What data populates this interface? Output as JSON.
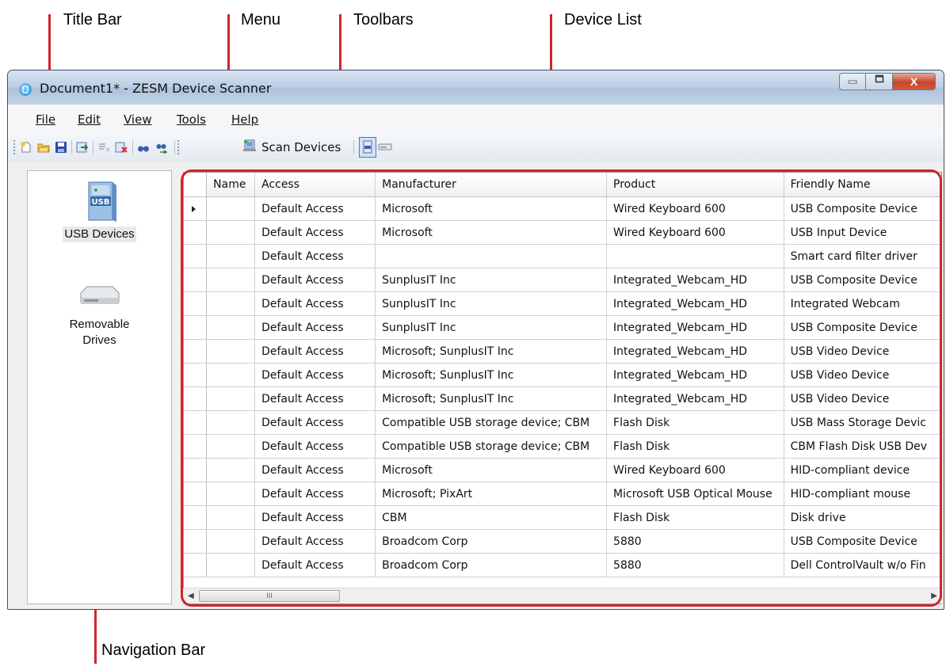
{
  "annotations": {
    "title_bar": "Title Bar",
    "menu": "Menu",
    "toolbars": "Toolbars",
    "device_list": "Device List",
    "navigation_bar": "Navigation Bar",
    "accent_color": "#d2232a"
  },
  "window": {
    "title": "Document1* - ZESM Device Scanner",
    "app_icon": "app-icon",
    "controls": {
      "minimize": "—",
      "maximize": "□",
      "close": "X"
    }
  },
  "menu": [
    {
      "label": "File"
    },
    {
      "label": "Edit"
    },
    {
      "label": "View"
    },
    {
      "label": "Tools"
    },
    {
      "label": "Help"
    }
  ],
  "toolbar": {
    "icons": [
      "new-document-icon",
      "open-folder-icon",
      "save-icon",
      "export-icon",
      "clear-icon",
      "delete-icon",
      "find-icon",
      "find-next-icon"
    ],
    "scan_label": "Scan Devices",
    "scan_icon": "scan-icon",
    "view_toggles": [
      "usb-view-icon",
      "drive-view-icon"
    ]
  },
  "navigation": {
    "items": [
      {
        "label": "USB Devices",
        "icon": "usb-device-icon",
        "selected": true
      },
      {
        "label": "Removable Drives",
        "icon": "removable-drive-icon",
        "selected": false
      }
    ]
  },
  "device_list": {
    "columns": [
      "Name",
      "Access",
      "Manufacturer",
      "Product",
      "Friendly Name"
    ],
    "rows": [
      [
        "",
        "Default Access",
        "Microsoft",
        "Wired Keyboard 600",
        "USB Composite Device"
      ],
      [
        "",
        "Default Access",
        "Microsoft",
        "Wired Keyboard 600",
        "USB Input Device"
      ],
      [
        "",
        "Default Access",
        "",
        "",
        "Smart card filter driver"
      ],
      [
        "",
        "Default Access",
        "SunplusIT Inc",
        "Integrated_Webcam_HD",
        "USB Composite Device"
      ],
      [
        "",
        "Default Access",
        "SunplusIT Inc",
        "Integrated_Webcam_HD",
        "Integrated Webcam"
      ],
      [
        "",
        "Default Access",
        "SunplusIT Inc",
        "Integrated_Webcam_HD",
        "USB Composite Device"
      ],
      [
        "",
        "Default Access",
        "Microsoft; SunplusIT Inc",
        "Integrated_Webcam_HD",
        "USB Video Device"
      ],
      [
        "",
        "Default Access",
        "Microsoft; SunplusIT Inc",
        "Integrated_Webcam_HD",
        "USB Video Device"
      ],
      [
        "",
        "Default Access",
        "Microsoft; SunplusIT Inc",
        "Integrated_Webcam_HD",
        "USB Video Device"
      ],
      [
        "",
        "Default Access",
        "Compatible USB storage device; CBM",
        "Flash Disk",
        "USB Mass Storage Devic"
      ],
      [
        "",
        "Default Access",
        "Compatible USB storage device; CBM",
        "Flash Disk",
        "CBM Flash Disk USB Dev"
      ],
      [
        "",
        "Default Access",
        "Microsoft",
        "Wired Keyboard 600",
        "HID-compliant device"
      ],
      [
        "",
        "Default Access",
        "Microsoft; PixArt",
        "Microsoft USB Optical Mouse",
        "HID-compliant mouse"
      ],
      [
        "",
        "Default Access",
        "CBM",
        "Flash Disk",
        "Disk drive"
      ],
      [
        "",
        "Default Access",
        "Broadcom Corp",
        "5880",
        "USB Composite Device"
      ],
      [
        "",
        "Default Access",
        "Broadcom Corp",
        "5880",
        "Dell ControlVault w/o Fin"
      ]
    ],
    "current_row": 0,
    "scrollbar_thumb_label": "III"
  }
}
